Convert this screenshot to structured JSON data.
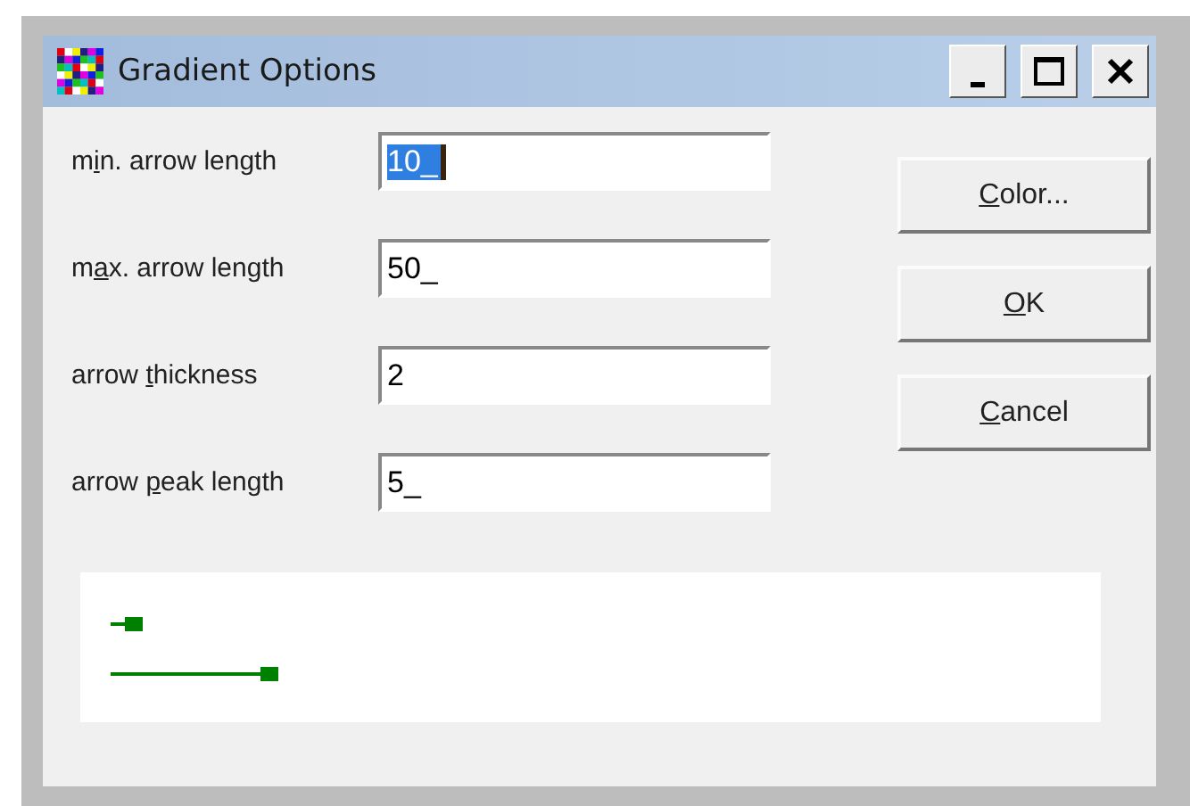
{
  "window": {
    "title": "Gradient Options"
  },
  "fields": [
    {
      "label": {
        "before": "m",
        "key": "i",
        "after": "n. arrow length"
      },
      "value": "10_",
      "focused": true
    },
    {
      "label": {
        "before": "m",
        "key": "a",
        "after": "x. arrow length"
      },
      "value": "50_",
      "focused": false
    },
    {
      "label": {
        "before": "arrow ",
        "key": "t",
        "after": "hickness"
      },
      "value": "2",
      "focused": false
    },
    {
      "label": {
        "before": "arrow ",
        "key": "p",
        "after": "eak length"
      },
      "value": "5_",
      "focused": false
    }
  ],
  "buttons": [
    {
      "label": {
        "key": "C",
        "after": "olor..."
      }
    },
    {
      "label": {
        "key": "O",
        "after": "K"
      }
    },
    {
      "label": {
        "key": "C",
        "after": "ancel"
      }
    }
  ]
}
